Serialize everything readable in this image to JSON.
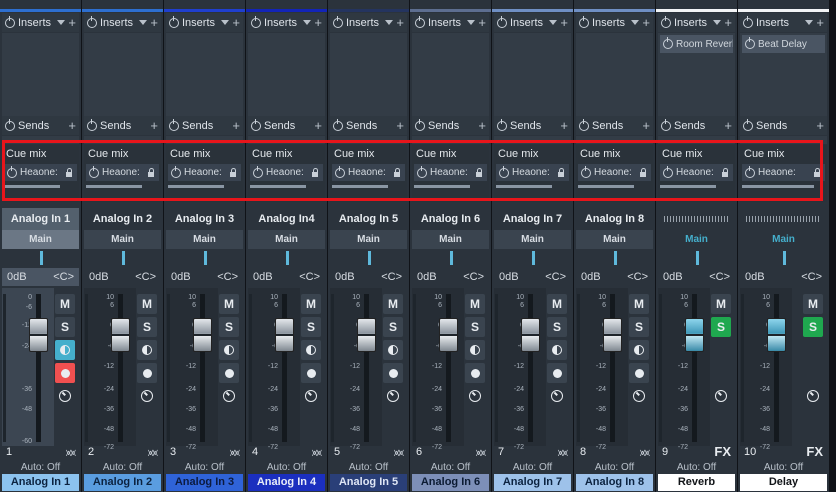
{
  "strips": [
    {
      "name": "Analog In 1",
      "bus": "Main",
      "pan": "<C>",
      "level": "0dB",
      "number": "1",
      "auto": "Auto: Off",
      "footer": "Analog In 1",
      "color": "#2d6fd0",
      "footer_bg": "#8cc3ef",
      "footer_fg": "#0c2340",
      "insert_slot": "",
      "cue_name": "Heaone:",
      "mute_active": false,
      "solo_active": false,
      "is_fx": false,
      "selected": true
    },
    {
      "name": "Analog In 2",
      "bus": "Main",
      "pan": "<C>",
      "level": "0dB",
      "number": "2",
      "auto": "Auto: Off",
      "footer": "Analog In 2",
      "color": "#2d6fd0",
      "footer_bg": "#5a9de0",
      "footer_fg": "#0c2340",
      "insert_slot": "",
      "cue_name": "Heaone:",
      "mute_active": false,
      "solo_active": false,
      "is_fx": false,
      "selected": false
    },
    {
      "name": "Analog In 3",
      "bus": "Main",
      "pan": "<C>",
      "level": "0dB",
      "number": "3",
      "auto": "Auto: Off",
      "footer": "Analog In 3",
      "color": "#1f3fcf",
      "footer_bg": "#2f63d8",
      "footer_fg": "#0c1b40",
      "insert_slot": "",
      "cue_name": "Heaone:",
      "mute_active": false,
      "solo_active": false,
      "is_fx": false,
      "selected": false
    },
    {
      "name": "Analog In4",
      "bus": "Main",
      "pan": "<C>",
      "level": "0dB",
      "number": "4",
      "auto": "Auto: Off",
      "footer": "Analog In 4",
      "color": "#1224b8",
      "footer_bg": "#1b2fbf",
      "footer_fg": "#e8ecf8",
      "insert_slot": "",
      "cue_name": "Heaone:",
      "mute_active": false,
      "solo_active": false,
      "is_fx": false,
      "selected": false
    },
    {
      "name": "Analog In 5",
      "bus": "Main",
      "pan": "<C>",
      "level": "0dB",
      "number": "5",
      "auto": "Auto: Off",
      "footer": "Analog In 5",
      "color": "#24345f",
      "footer_bg": "#2a3f78",
      "footer_fg": "#dfe6f5",
      "insert_slot": "",
      "cue_name": "Heaone:",
      "mute_active": false,
      "solo_active": false,
      "is_fx": false,
      "selected": false
    },
    {
      "name": "Analog In 6",
      "bus": "Main",
      "pan": "<C>",
      "level": "0dB",
      "number": "6",
      "auto": "Auto: Off",
      "footer": "Analog In 6",
      "color": "#5d6e90",
      "footer_bg": "#7d8fb8",
      "footer_fg": "#0c1b33",
      "insert_slot": "",
      "cue_name": "Heaone:",
      "mute_active": false,
      "solo_active": false,
      "is_fx": false,
      "selected": false
    },
    {
      "name": "Analog In 7",
      "bus": "Main",
      "pan": "<C>",
      "level": "0dB",
      "number": "7",
      "auto": "Auto: Off",
      "footer": "Analog In 7",
      "color": "#6f8fc4",
      "footer_bg": "#9ec2ea",
      "footer_fg": "#0c2340",
      "insert_slot": "",
      "cue_name": "Heaone:",
      "mute_active": false,
      "solo_active": false,
      "is_fx": false,
      "selected": false
    },
    {
      "name": "Analog In 8",
      "bus": "Main",
      "pan": "<C>",
      "level": "0dB",
      "number": "8",
      "auto": "Auto: Off",
      "footer": "Analog In 8",
      "color": "#6f8fc4",
      "footer_bg": "#9ec2ea",
      "footer_fg": "#0c2340",
      "insert_slot": "",
      "cue_name": "Heaone:",
      "mute_active": false,
      "solo_active": false,
      "is_fx": false,
      "selected": false
    },
    {
      "name": "",
      "bus": "Main",
      "pan": "<C>",
      "level": "0dB",
      "number": "9",
      "auto": "Auto: Off",
      "footer": "Reverb",
      "color": "#f2f4f6",
      "footer_bg": "#ffffff",
      "footer_fg": "#111418",
      "insert_slot": "Room Reverb",
      "cue_name": "Heaone:",
      "mute_active": false,
      "solo_active": true,
      "is_fx": true,
      "selected": false
    },
    {
      "name": "",
      "bus": "Main",
      "pan": "<C>",
      "level": "0dB",
      "number": "10",
      "auto": "Auto: Off",
      "footer": "Delay",
      "color": "#f2f4f6",
      "footer_bg": "#ffffff",
      "footer_fg": "#111418",
      "insert_slot": "Beat Delay",
      "cue_name": "Heaone:",
      "mute_active": false,
      "solo_active": true,
      "is_fx": true,
      "selected": false
    }
  ],
  "labels": {
    "inserts": "Inserts",
    "sends": "Sends",
    "cue_mix": "Cue mix",
    "mute": "M",
    "solo": "S",
    "fx": "FX"
  },
  "scale_ticks": [
    "10",
    "6",
    "0",
    "-6",
    "-12",
    "-24",
    "-36",
    "-48",
    "-72"
  ],
  "first_scale_ticks": [
    "0",
    "-6",
    "-12",
    "-24",
    "-36",
    "-48",
    "-60"
  ],
  "icons": {
    "power": "power-icon",
    "lock": "lock-icon",
    "dropdown": "dropdown-icon",
    "add": "add-icon",
    "waveform": "waveform-icon"
  },
  "colors": {
    "highlight": "#e8151b",
    "cyan": "#45afcc",
    "red": "#f05050",
    "green": "#1fa84f"
  }
}
